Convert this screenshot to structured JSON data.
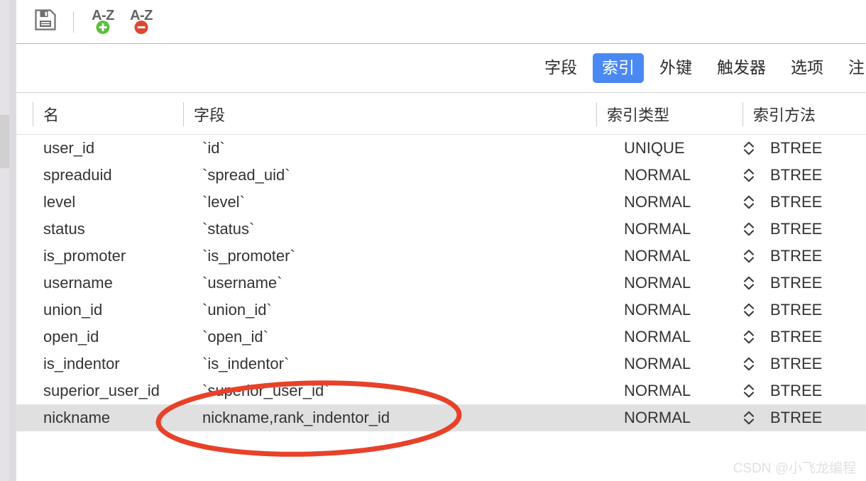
{
  "colors": {
    "accent_blue": "#4a89f3",
    "badge_green": "#5bbf3f",
    "badge_red": "#e0452f",
    "annotation_red": "#e8412a",
    "selected_row": "#e0e0e0",
    "text": "#333333",
    "watermark": "#c9c9c9"
  },
  "toolbar": {
    "save_label": "",
    "save_icon": "floppy-disk-save-icon",
    "add_index_label": "A-Z",
    "add_index_icon": "plus-badge-icon",
    "delete_index_label": "A-Z",
    "delete_index_icon": "minus-badge-icon"
  },
  "tabs": [
    {
      "label": "字段",
      "name": "tab-fields",
      "active": false
    },
    {
      "label": "索引",
      "name": "tab-indexes",
      "active": true
    },
    {
      "label": "外键",
      "name": "tab-foreign-keys",
      "active": false
    },
    {
      "label": "触发器",
      "name": "tab-triggers",
      "active": false
    },
    {
      "label": "选项",
      "name": "tab-options",
      "active": false
    },
    {
      "label": "注",
      "name": "tab-comment",
      "active": false
    }
  ],
  "grid": {
    "columns": [
      {
        "label": "名",
        "key": "name"
      },
      {
        "label": "字段",
        "key": "field"
      },
      {
        "label": "索引类型",
        "key": "index_type"
      },
      {
        "label": "索引方法",
        "key": "index_method"
      }
    ],
    "rows": [
      {
        "name": "user_id",
        "field": "`id`",
        "index_type": "UNIQUE",
        "index_method": "BTREE",
        "selected": false
      },
      {
        "name": "spreaduid",
        "field": "`spread_uid`",
        "index_type": "NORMAL",
        "index_method": "BTREE",
        "selected": false
      },
      {
        "name": "level",
        "field": "`level`",
        "index_type": "NORMAL",
        "index_method": "BTREE",
        "selected": false
      },
      {
        "name": "status",
        "field": "`status`",
        "index_type": "NORMAL",
        "index_method": "BTREE",
        "selected": false
      },
      {
        "name": "is_promoter",
        "field": "`is_promoter`",
        "index_type": "NORMAL",
        "index_method": "BTREE",
        "selected": false
      },
      {
        "name": "username",
        "field": "`username`",
        "index_type": "NORMAL",
        "index_method": "BTREE",
        "selected": false
      },
      {
        "name": "union_id",
        "field": "`union_id`",
        "index_type": "NORMAL",
        "index_method": "BTREE",
        "selected": false
      },
      {
        "name": "open_id",
        "field": "`open_id`",
        "index_type": "NORMAL",
        "index_method": "BTREE",
        "selected": false
      },
      {
        "name": "is_indentor",
        "field": "`is_indentor`",
        "index_type": "NORMAL",
        "index_method": "BTREE",
        "selected": false
      },
      {
        "name": "superior_user_id",
        "field": "`superior_user_id`",
        "index_type": "NORMAL",
        "index_method": "BTREE",
        "selected": false
      },
      {
        "name": "nickname",
        "field": "nickname,rank_indentor_id",
        "index_type": "NORMAL",
        "index_method": "BTREE",
        "selected": true
      }
    ]
  },
  "annotation": {
    "shape": "ellipse",
    "target_row": "nickname",
    "target_cell": "field"
  },
  "watermark": {
    "text": "CSDN @小飞龙编程"
  }
}
